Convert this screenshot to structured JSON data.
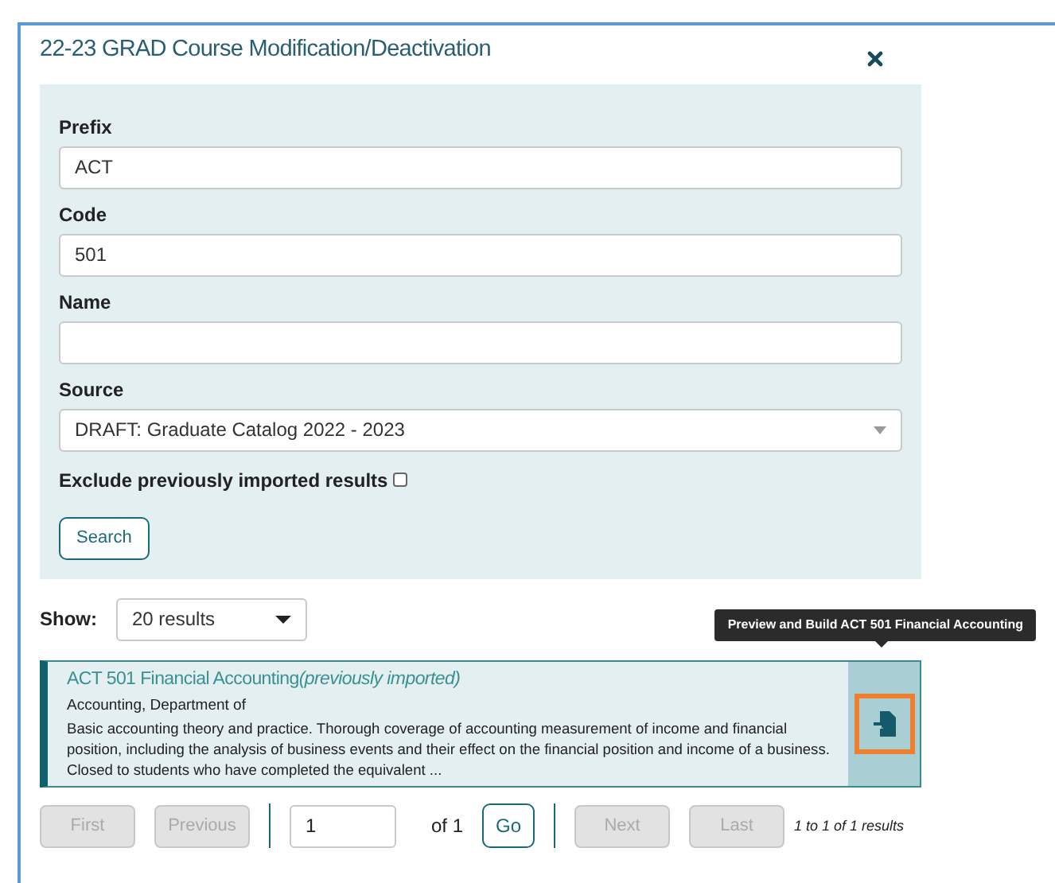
{
  "dialog": {
    "title": "22-23 GRAD Course Modification/Deactivation"
  },
  "form": {
    "fields": [
      {
        "label": "Prefix",
        "kind": "text",
        "value": "ACT"
      },
      {
        "label": "Code",
        "kind": "text",
        "value": "501"
      },
      {
        "label": "Name",
        "kind": "text"
      },
      {
        "label": "Source",
        "kind": "select",
        "value": "DRAFT: Graduate Catalog 2022 - 2023"
      }
    ],
    "exclude": {
      "label": "Exclude previously imported results",
      "checked": false
    },
    "search_button": "Search"
  },
  "show": {
    "label": "Show:",
    "value": "20 results"
  },
  "results": [
    {
      "title": "ACT 501 Financial Accounting",
      "note": "(previously imported)",
      "department": "Accounting, Department of",
      "description": "Basic accounting theory and practice. Thorough coverage of accounting measurement of income and financial position, including the analysis of business events and their effect on the financial position and income of a business. Closed to students who have completed the equivalent ...",
      "tooltip": "Preview and Build ACT 501 Financial Accounting"
    }
  ],
  "pagination": {
    "first": {
      "label": "First",
      "disabled": true
    },
    "previous": {
      "label": "Previous",
      "disabled": true
    },
    "page": "1",
    "of": "of 1",
    "go": "Go",
    "next": {
      "label": "Next",
      "disabled": true
    },
    "last": {
      "label": "Last",
      "disabled": true
    },
    "summary": "1 to 1 of 1 results"
  }
}
